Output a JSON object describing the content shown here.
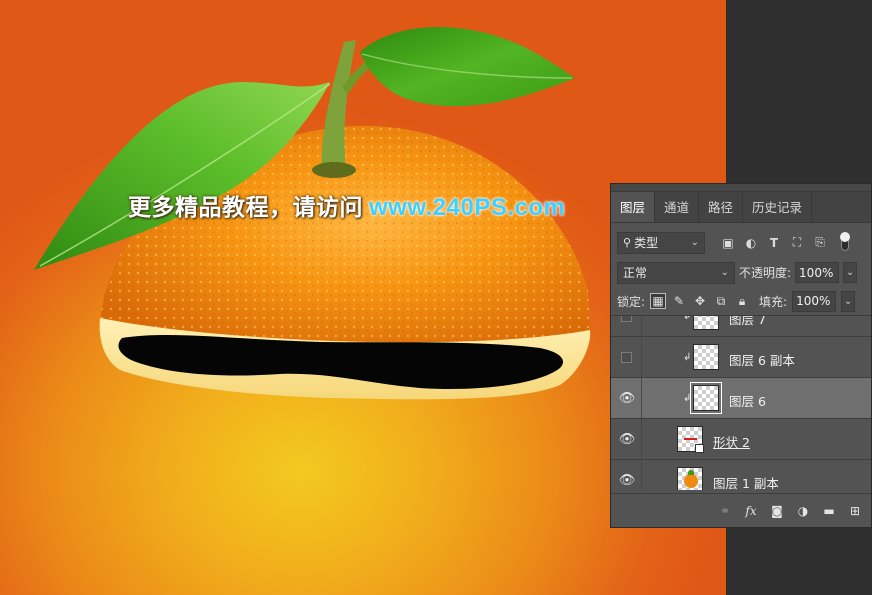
{
  "watermark": {
    "text_cn": "更多精品教程，请访问",
    "url": "www.240PS.com"
  },
  "colors": {
    "background_orange": "#e05816",
    "background_glow": "#f3c920",
    "panel_bg": "#535353",
    "selected_row": "#6f6f6f",
    "watermark_url": "#3fd0ff"
  },
  "layers_panel": {
    "tabs": [
      {
        "label": "图层",
        "active": true
      },
      {
        "label": "通道",
        "active": false
      },
      {
        "label": "路径",
        "active": false
      },
      {
        "label": "历史记录",
        "active": false
      }
    ],
    "filter": {
      "kind_label": "类型",
      "icons": [
        "image-filter-icon",
        "adjustment-filter-icon",
        "type-filter-icon",
        "shape-filter-icon",
        "smartobject-filter-icon"
      ]
    },
    "blend_mode": "正常",
    "opacity_label": "不透明度:",
    "opacity_value": "100%",
    "lock_label": "锁定:",
    "fill_label": "填充:",
    "fill_value": "100%",
    "layers": [
      {
        "name": "图层 7",
        "visible": false,
        "clipped": true,
        "selected": false,
        "underlined": false
      },
      {
        "name": "图层 6 副本",
        "visible": false,
        "clipped": true,
        "selected": false,
        "underlined": false
      },
      {
        "name": "图层 6",
        "visible": true,
        "clipped": true,
        "selected": true,
        "underlined": false
      },
      {
        "name": "形状 2",
        "visible": true,
        "clipped": false,
        "selected": false,
        "underlined": true
      },
      {
        "name": "图层 1 副本",
        "visible": true,
        "clipped": false,
        "selected": false,
        "underlined": false
      }
    ],
    "bottom_icons": [
      "link-icon",
      "fx-icon",
      "mask-icon",
      "adjustment-icon",
      "folder-icon",
      "new-layer-icon"
    ]
  }
}
